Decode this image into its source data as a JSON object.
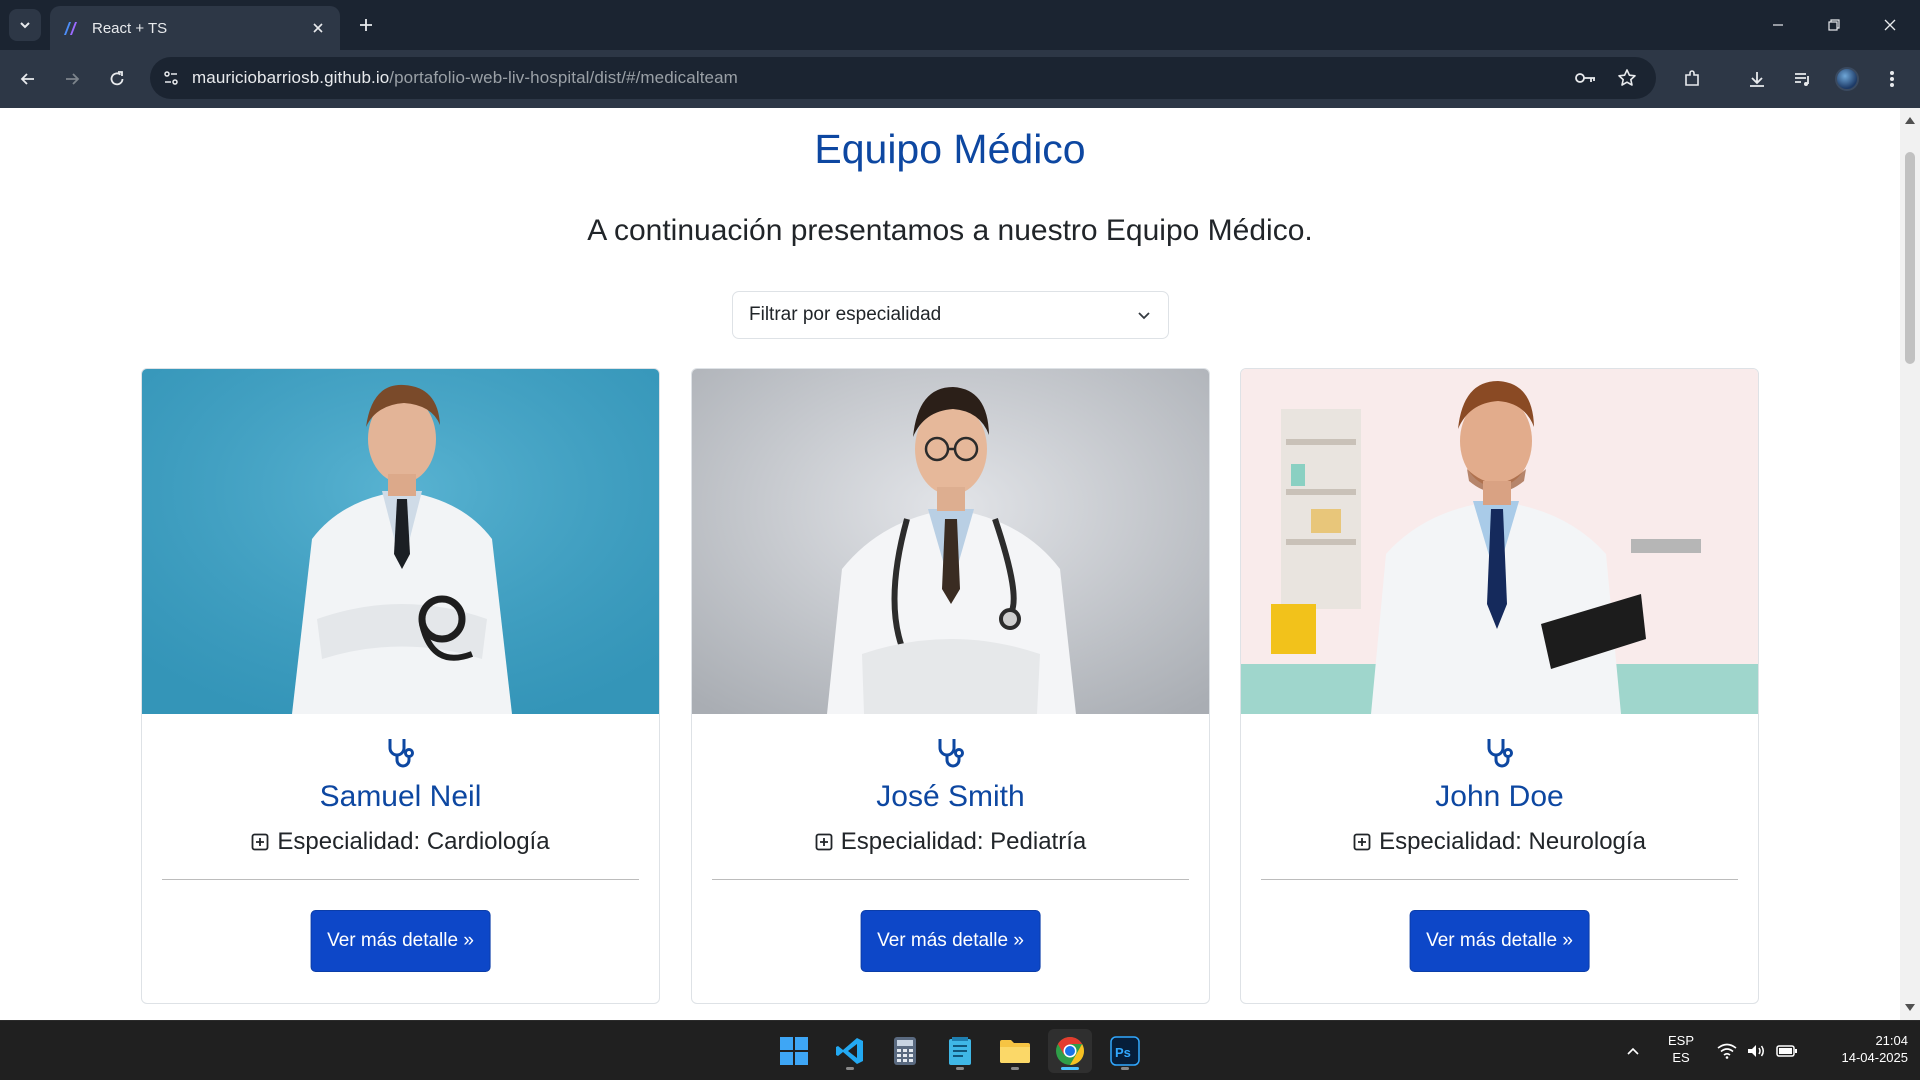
{
  "browser": {
    "tab_title": "React + TS",
    "url_host": "mauriciobarriosb.github.io",
    "url_path": "/portafolio-web-liv-hospital/dist/#/medicalteam"
  },
  "page": {
    "title": "Equipo Médico",
    "subtitle": "A continuación presentamos a nuestro Equipo Médico.",
    "filter_label": "Filtrar por especialidad"
  },
  "doctors": [
    {
      "name": "Samuel Neil",
      "specialty": "Especialidad: Cardiología",
      "button": "Ver más detalle »"
    },
    {
      "name": "José Smith",
      "specialty": "Especialidad: Pediatría",
      "button": "Ver más detalle »"
    },
    {
      "name": "John Doe",
      "specialty": "Especialidad: Neurología",
      "button": "Ver más detalle »"
    }
  ],
  "taskbar": {
    "lang_top": "ESP",
    "lang_bottom": "ES",
    "time": "21:04",
    "date": "14-04-2025",
    "apps": [
      "windows-start",
      "vscode",
      "calculator",
      "notepad",
      "file-explorer",
      "chrome",
      "photoshop"
    ]
  },
  "colors": {
    "accent_blue": "#0d47a1",
    "button_blue": "#0d47c8",
    "chrome_dark": "#1b2431",
    "taskbar": "#202020"
  }
}
